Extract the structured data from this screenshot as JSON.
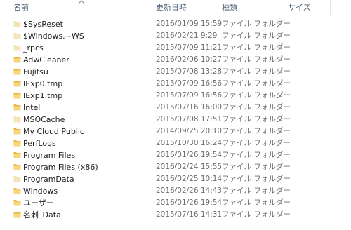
{
  "header": {
    "name_label": "名前",
    "date_label": "更新日時",
    "type_label": "種類",
    "size_label": "サイズ"
  },
  "colors": {
    "folder": "#e8b93f",
    "folder_light": "#f6d67a",
    "folder_hidden": "#f1dba3",
    "header_text": "#4c607a",
    "meta_text": "#6d6d6d"
  },
  "icons": {
    "folder": "folder-icon",
    "sort": "sort-up-icon"
  },
  "files": [
    {
      "name": "$SysReset",
      "date": "2016/01/09 15:59",
      "type": "ファイル フォルダー",
      "hidden": true
    },
    {
      "name": "$Windows.~WS",
      "date": "2016/02/21 9:29",
      "type": "ファイル フォルダー",
      "hidden": true
    },
    {
      "name": "_rpcs",
      "date": "2015/07/09 11:21",
      "type": "ファイル フォルダー",
      "hidden": true
    },
    {
      "name": "AdwCleaner",
      "date": "2016/02/06 10:27",
      "type": "ファイル フォルダー",
      "hidden": false
    },
    {
      "name": "Fujitsu",
      "date": "2015/07/08 13:28",
      "type": "ファイル フォルダー",
      "hidden": false
    },
    {
      "name": "IExp0.tmp",
      "date": "2015/07/09 16:56",
      "type": "ファイル フォルダー",
      "hidden": false
    },
    {
      "name": "IExp1.tmp",
      "date": "2015/07/09 16:56",
      "type": "ファイル フォルダー",
      "hidden": false
    },
    {
      "name": "Intel",
      "date": "2015/07/16 16:00",
      "type": "ファイル フォルダー",
      "hidden": false
    },
    {
      "name": "MSOCache",
      "date": "2015/07/08 17:51",
      "type": "ファイル フォルダー",
      "hidden": true
    },
    {
      "name": "My Cloud Public",
      "date": "2014/09/25 20:10",
      "type": "ファイル フォルダー",
      "hidden": false
    },
    {
      "name": "PerfLogs",
      "date": "2015/10/30 16:24",
      "type": "ファイル フォルダー",
      "hidden": false
    },
    {
      "name": "Program Files",
      "date": "2016/01/26 19:54",
      "type": "ファイル フォルダー",
      "hidden": false
    },
    {
      "name": "Program Files (x86)",
      "date": "2016/02/24 15:55",
      "type": "ファイル フォルダー",
      "hidden": false
    },
    {
      "name": "ProgramData",
      "date": "2016/02/25 10:14",
      "type": "ファイル フォルダー",
      "hidden": true
    },
    {
      "name": "Windows",
      "date": "2016/02/26 14:43",
      "type": "ファイル フォルダー",
      "hidden": false
    },
    {
      "name": "ユーザー",
      "date": "2016/01/26 19:54",
      "type": "ファイル フォルダー",
      "hidden": false
    },
    {
      "name": "名刺_Data",
      "date": "2015/07/16 14:31",
      "type": "ファイル フォルダー",
      "hidden": false
    }
  ]
}
